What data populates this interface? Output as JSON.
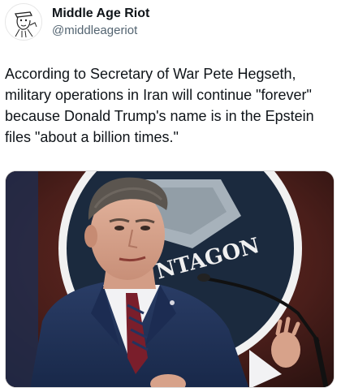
{
  "post": {
    "author": {
      "display_name": "Middle Age Riot",
      "handle": "@middleageriot",
      "avatar_icon": "sketch-portrait-avatar"
    },
    "text": "According to Secretary of War Pete Hegseth, military operations in Iran will continue \"forever\" because Donald Trump's name is in the Epstein files \"about a billion times.\"",
    "media": {
      "type": "photo",
      "icon": "press-conference-photo",
      "visible_text": "NTAGON"
    }
  }
}
